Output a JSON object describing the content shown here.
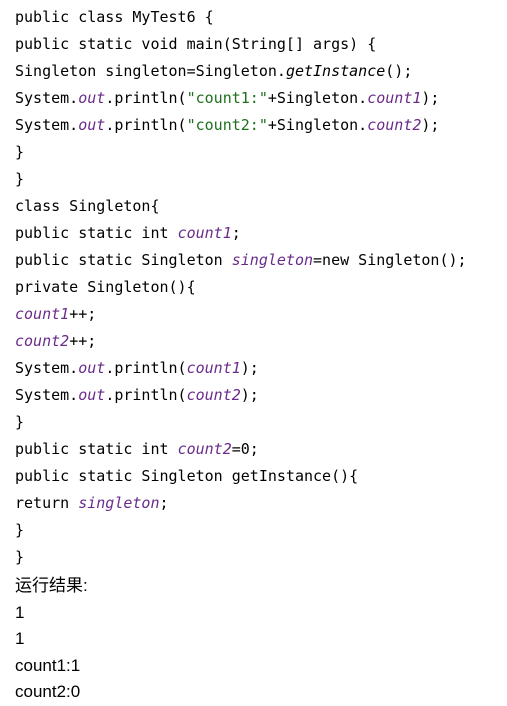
{
  "code": {
    "lines": [
      [
        {
          "t": "public class MyTest6 {"
        }
      ],
      [
        {
          "t": "public static void main(String[] args) {"
        }
      ],
      [
        {
          "t": "Singleton singleton=Singleton."
        },
        {
          "t": "getInstance",
          "s": "it"
        },
        {
          "t": "();"
        }
      ],
      [
        {
          "t": "System."
        },
        {
          "t": "out",
          "s": "it purple"
        },
        {
          "t": ".println("
        },
        {
          "t": "\"count1:\"",
          "s": "green"
        },
        {
          "t": "+Singleton."
        },
        {
          "t": "count1",
          "s": "it purple"
        },
        {
          "t": ");"
        }
      ],
      [
        {
          "t": "System."
        },
        {
          "t": "out",
          "s": "it purple"
        },
        {
          "t": ".println("
        },
        {
          "t": "\"count2:\"",
          "s": "green"
        },
        {
          "t": "+Singleton."
        },
        {
          "t": "count2",
          "s": "it purple"
        },
        {
          "t": ");"
        }
      ],
      [
        {
          "t": "}"
        }
      ],
      [
        {
          "t": "}"
        }
      ],
      [
        {
          "t": "class Singleton{"
        }
      ],
      [
        {
          "t": "public static int "
        },
        {
          "t": "count1",
          "s": "it purple"
        },
        {
          "t": ";"
        }
      ],
      [
        {
          "t": "public static Singleton "
        },
        {
          "t": "singleton",
          "s": "it purple"
        },
        {
          "t": "=new Singleton();"
        }
      ],
      [
        {
          "t": "private Singleton(){"
        }
      ],
      [
        {
          "t": "count1",
          "s": "it purple"
        },
        {
          "t": "++;"
        }
      ],
      [
        {
          "t": "count2",
          "s": "it purple"
        },
        {
          "t": "++;"
        }
      ],
      [
        {
          "t": "System."
        },
        {
          "t": "out",
          "s": "it purple"
        },
        {
          "t": ".println("
        },
        {
          "t": "count1",
          "s": "it purple"
        },
        {
          "t": ");"
        }
      ],
      [
        {
          "t": "System."
        },
        {
          "t": "out",
          "s": "it purple"
        },
        {
          "t": ".println("
        },
        {
          "t": "count2",
          "s": "it purple"
        },
        {
          "t": ");"
        }
      ],
      [
        {
          "t": "}"
        }
      ],
      [
        {
          "t": "public static int "
        },
        {
          "t": "count2",
          "s": "it purple"
        },
        {
          "t": "=0;"
        }
      ],
      [
        {
          "t": "public static Singleton getInstance(){"
        }
      ],
      [
        {
          "t": "return "
        },
        {
          "t": "singleton",
          "s": "it purple"
        },
        {
          "t": ";"
        }
      ],
      [
        {
          "t": "}"
        }
      ],
      [
        {
          "t": "}"
        }
      ]
    ]
  },
  "output": {
    "heading": "运行结果:",
    "lines": [
      "1",
      "1",
      "count1:1",
      "count2:0"
    ]
  }
}
